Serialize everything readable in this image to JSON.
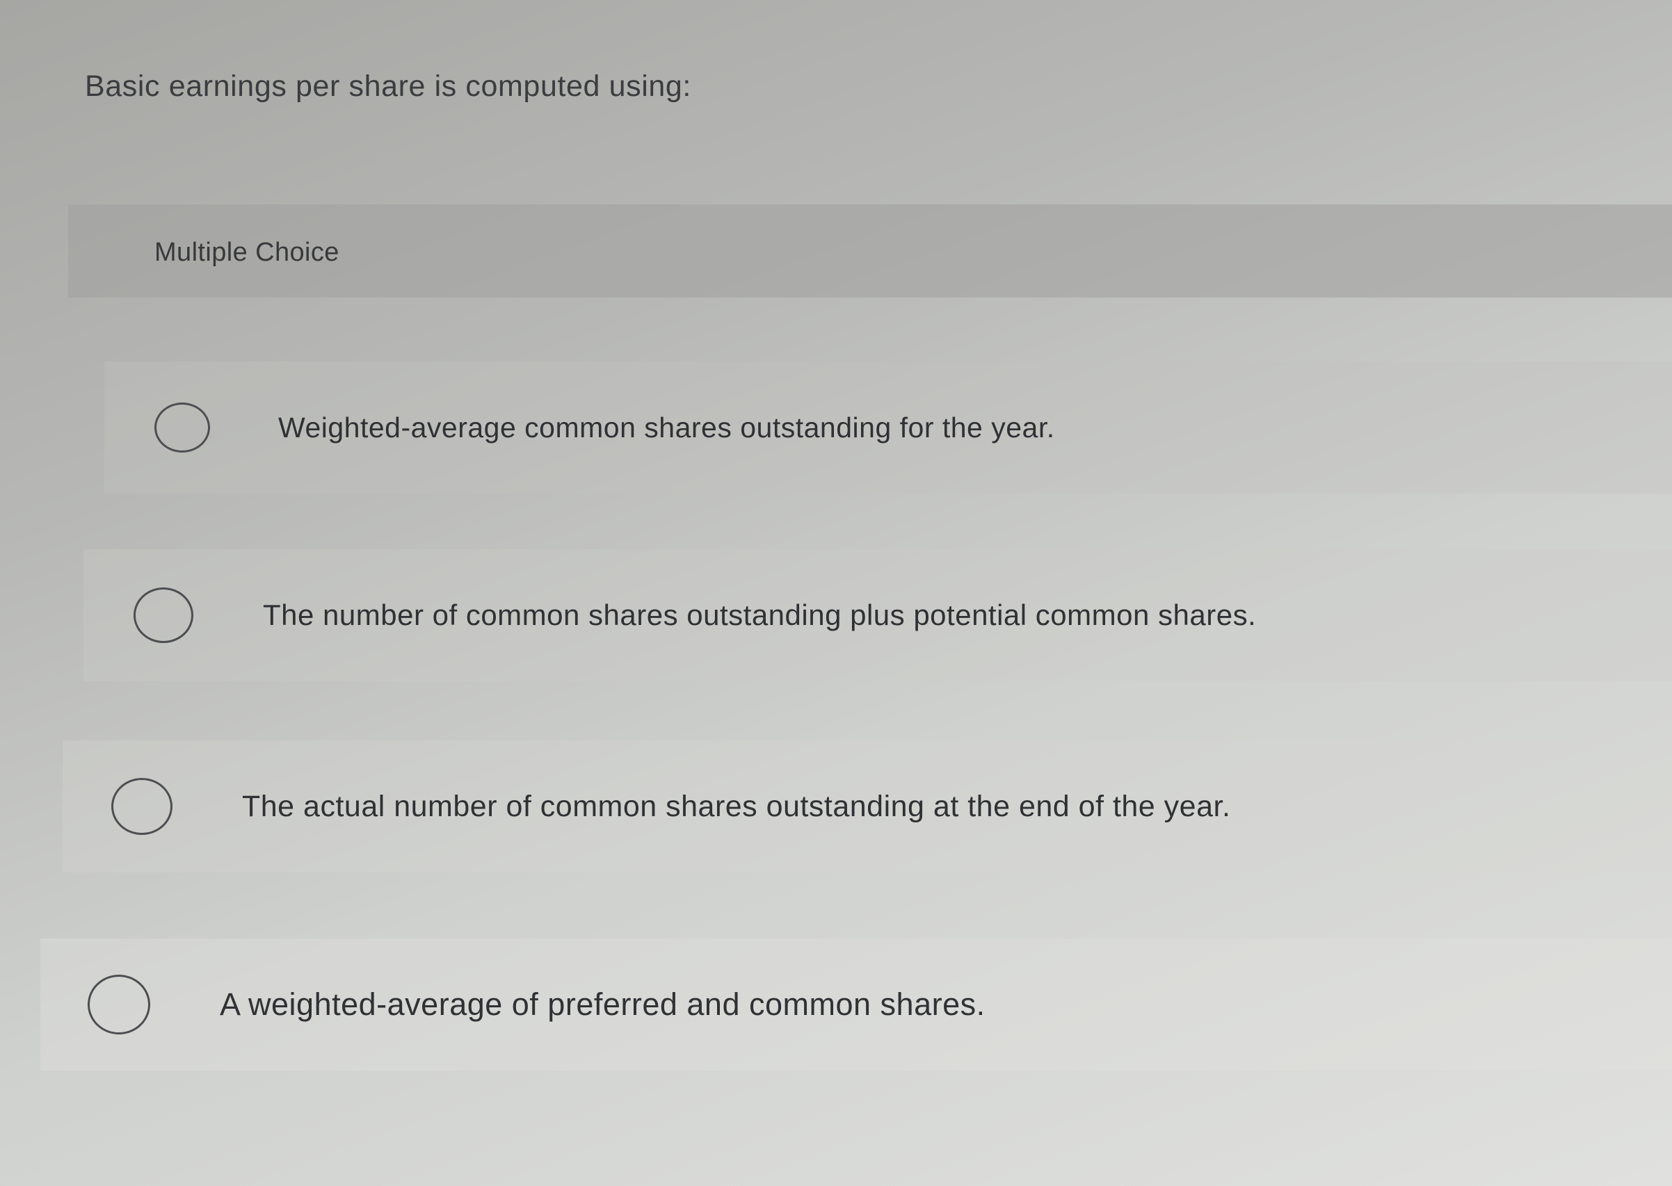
{
  "question": {
    "text": "Basic earnings per share is computed using:"
  },
  "multiple_choice": {
    "label": "Multiple Choice",
    "options": [
      {
        "text": "Weighted-average common shares outstanding for the year.",
        "selected": false
      },
      {
        "text": "The number of common shares outstanding plus potential common shares.",
        "selected": false
      },
      {
        "text": "The actual number of common shares outstanding at the end of the year.",
        "selected": false
      },
      {
        "text": "A weighted-average of preferred and common shares.",
        "selected": false
      }
    ]
  },
  "colors": {
    "text": "#2f3134",
    "radio_border": "#4c4e51",
    "header_band": "#a0a19f"
  }
}
